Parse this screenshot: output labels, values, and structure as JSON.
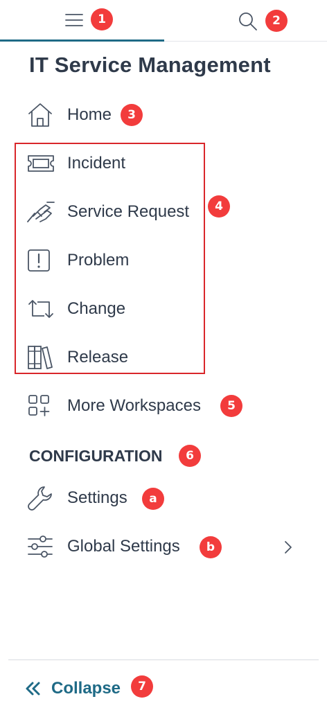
{
  "topbar": {
    "menu_badge": "1",
    "search_badge": "2"
  },
  "app_title": "IT Service Management",
  "nav": {
    "home": {
      "label": "Home",
      "badge": "3"
    },
    "workspaces": [
      {
        "label": "Incident",
        "icon": "ticket-icon"
      },
      {
        "label": "Service Request",
        "icon": "handshake-icon"
      },
      {
        "label": "Problem",
        "icon": "alert-square-icon"
      },
      {
        "label": "Change",
        "icon": "swap-arrows-icon"
      },
      {
        "label": "Release",
        "icon": "books-icon"
      }
    ],
    "workspaces_badge": "4",
    "more_workspaces": {
      "label": "More Workspaces",
      "badge": "5"
    }
  },
  "configuration": {
    "title": "CONFIGURATION",
    "badge": "6",
    "items": [
      {
        "label": "Settings",
        "badge": "a",
        "icon": "wrench-icon"
      },
      {
        "label": "Global Settings",
        "badge": "b",
        "icon": "sliders-icon"
      }
    ]
  },
  "footer": {
    "collapse_label": "Collapse",
    "badge": "7"
  },
  "colors": {
    "accent": "#1e6a86",
    "badge": "#f23c3c",
    "text": "#2f3a4a",
    "highlight_border": "#d9262a"
  }
}
